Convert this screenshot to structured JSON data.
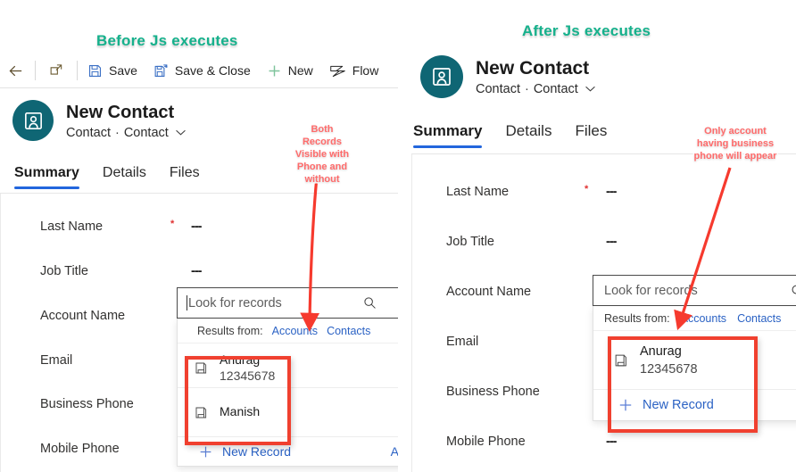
{
  "captions": {
    "before": "Before Js executes",
    "after": "After Js executes",
    "color": "#16b18c"
  },
  "annotations": {
    "left": "Both\nRecords\nVisible with\nPhone and\nwithout",
    "right": "Only account\nhaving business\nphone will appear",
    "color": "#ff6b6b",
    "highlight_box_color": "#f0402f"
  },
  "commandbar": {
    "back_icon": "back-arrow-icon",
    "popout_icon": "open-in-new-window-icon",
    "save_label": "Save",
    "save_icon": "save-disk-icon",
    "save_close_label": "Save & Close",
    "save_close_icon": "save-and-close-icon",
    "new_label": "New",
    "new_icon": "plus-icon",
    "flow_label": "Flow",
    "flow_icon": "flow-icon"
  },
  "record": {
    "title": "New Contact",
    "entity": "Contact",
    "form": "Contact",
    "separator": "·",
    "chevron": "chevron-down-icon",
    "avatar_icon": "contact-card-icon",
    "avatar_color": "#0f6674"
  },
  "tabs": [
    {
      "label": "Summary",
      "active": true
    },
    {
      "label": "Details",
      "active": false
    },
    {
      "label": "Files",
      "active": false
    }
  ],
  "form": {
    "fields": [
      {
        "label": "Last Name",
        "required": true,
        "value": "---"
      },
      {
        "label": "Job Title",
        "required": false,
        "value": "---"
      },
      {
        "label": "Account Name",
        "required": false,
        "value": ""
      },
      {
        "label": "Email",
        "required": false,
        "value": ""
      },
      {
        "label": "Business Phone",
        "required": false,
        "value": ""
      },
      {
        "label": "Mobile Phone",
        "required": false,
        "value": "---"
      }
    ]
  },
  "lookup": {
    "placeholder": "Look for records",
    "search_icon": "search-icon",
    "results_from_label": "Results from:",
    "sources": [
      {
        "label": "Accounts"
      },
      {
        "label": "Contacts"
      }
    ],
    "new_record_label": "New Record",
    "new_record_icon": "plus-icon",
    "advanced_trail": "A",
    "record_icon": "record-card-icon"
  },
  "panel_left": {
    "results": [
      {
        "name": "Anurag",
        "phone": "12345678"
      },
      {
        "name": "Manish",
        "phone": ""
      }
    ]
  },
  "panel_right": {
    "results": [
      {
        "name": "Anurag",
        "phone": "12345678"
      }
    ]
  }
}
